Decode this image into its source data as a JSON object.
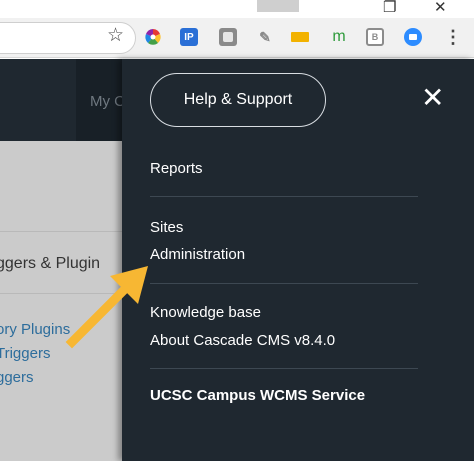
{
  "menu": {
    "help_button": "Help & Support",
    "close_glyph": "✕",
    "items": [
      {
        "label": "Reports"
      },
      {
        "label": "Sites"
      },
      {
        "label": "Administration"
      },
      {
        "label": "Knowledge base"
      },
      {
        "label": "About Cascade CMS v8.4.0"
      },
      {
        "label": "UCSC Campus WCMS Service"
      }
    ]
  },
  "background_page": {
    "nav_link": "My C",
    "section_heading": "ggers & Plugin",
    "links": [
      "ory Plugins",
      "Triggers",
      "ggers"
    ]
  },
  "browser": {
    "bookmark_glyph": "☆",
    "menu_glyph": "⋮",
    "extensions": [
      {
        "name": "color-wheel-icon",
        "label": "",
        "color": "#e0356f"
      },
      {
        "name": "ip-icon",
        "label": "IP",
        "color": "#2a6fd6"
      },
      {
        "name": "tile-icon",
        "label": "",
        "color": "#7a7a7a"
      },
      {
        "name": "pencil-icon",
        "label": "",
        "color": "#9a9a9a"
      },
      {
        "name": "ruler-icon",
        "label": "",
        "color": "#f2b200"
      },
      {
        "name": "m-icon",
        "label": "m",
        "color": "#2e9b3b"
      },
      {
        "name": "bi-icon",
        "label": "B",
        "color": "#8c8c8c"
      },
      {
        "name": "zoom-icon",
        "label": "",
        "color": "#2d8cff"
      }
    ]
  },
  "colors": {
    "panel_bg": "#1f2830",
    "arrow": "#f7b733",
    "link": "#2d6d9c"
  }
}
